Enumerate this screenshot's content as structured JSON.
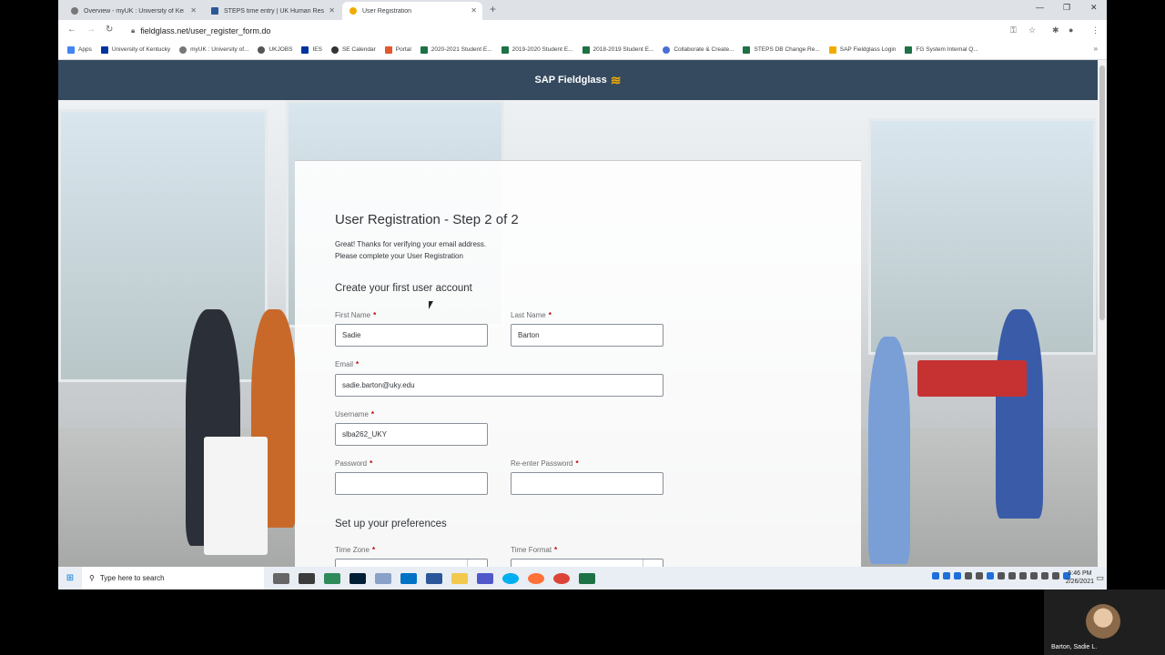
{
  "browser": {
    "tabs": [
      {
        "title": "Overview - myUK : University of Kent",
        "active": false
      },
      {
        "title": "STEPS time entry | UK Human Resou",
        "active": false
      },
      {
        "title": "User Registration",
        "active": true
      }
    ],
    "url": "fieldglass.net/user_register_form.do",
    "bookmarks": [
      "Apps",
      "University of Kentucky",
      "myUK : University of...",
      "UKJOBS",
      "IES",
      "SE Calendar",
      "Portal",
      "2020-2021 Student E...",
      "2019-2020 Student E...",
      "2018-2019 Student E...",
      "Collaborate & Create...",
      "STEPS DB Change Re...",
      "SAP Fieldglass Login",
      "FG System Internal Q..."
    ]
  },
  "header": {
    "brand": "SAP Fieldglass"
  },
  "form": {
    "title": "User Registration - Step 2 of 2",
    "message_line1": "Great! Thanks for verifying your email address.",
    "message_line2": "Please complete your User Registration",
    "section_account": "Create your first user account",
    "first_name_label": "First Name",
    "first_name_value": "Sadie",
    "last_name_label": "Last Name",
    "last_name_value": "Barton",
    "email_label": "Email",
    "email_value": "sadie.barton@uky.edu",
    "username_label": "Username",
    "username_value": "slba262_UKY",
    "password_label": "Password",
    "password_value": "",
    "reenter_password_label": "Re-enter Password",
    "reenter_password_value": "",
    "section_preferences": "Set up your preferences",
    "time_zone_label": "Time Zone",
    "time_format_label": "Time Format",
    "required_marker": "*"
  },
  "taskbar": {
    "search_placeholder": "Type here to search",
    "time": "5:46 PM",
    "date": "2/26/2021"
  },
  "webcam": {
    "name": "Barton, Sadie L."
  }
}
